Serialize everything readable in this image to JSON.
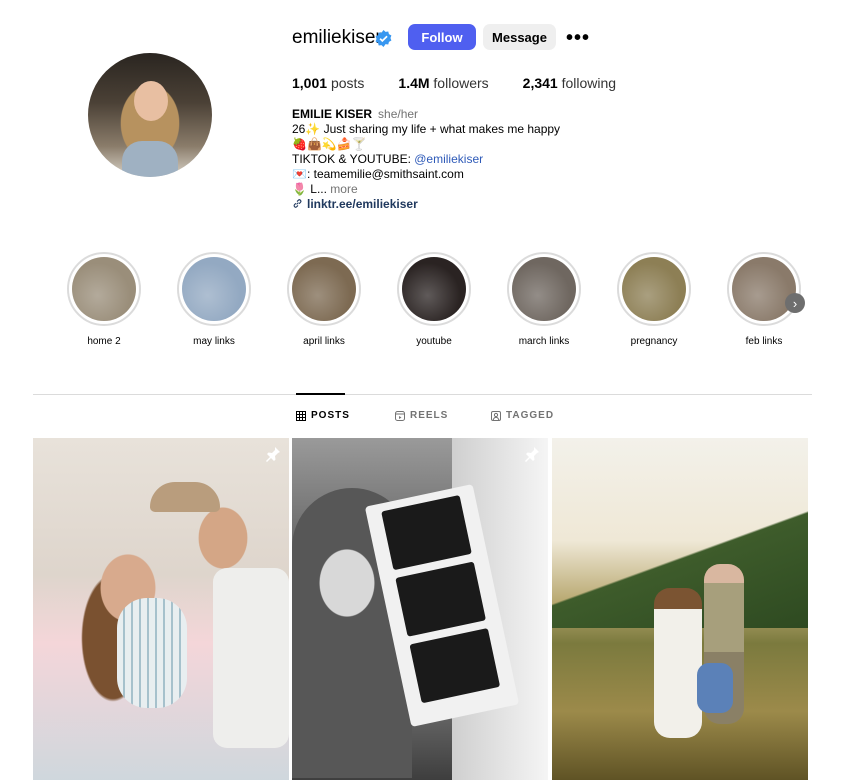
{
  "profile": {
    "username": "emiliekiser",
    "follow_label": "Follow",
    "message_label": "Message",
    "more_label": "•••"
  },
  "stats": {
    "posts_count": "1,001",
    "posts_label": "posts",
    "followers_count": "1.4M",
    "followers_label": "followers",
    "following_count": "2,341",
    "following_label": "following"
  },
  "bio": {
    "name": "EMILIE KISER",
    "pronouns": "she/her",
    "line1": "26✨ Just sharing my life + what makes me happy",
    "line2": "🍓👜💫🍰🍸",
    "line3_prefix": "TIKTOK & YOUTUBE: ",
    "line3_mention": "@emiliekiser",
    "line4": "💌: teamemilie@smithsaint.com",
    "line5_prefix": "🌷 L... ",
    "line5_more": "more",
    "link": "linktr.ee/emiliekiser"
  },
  "highlights": [
    {
      "label": "home 2",
      "color": "#9a8e7a"
    },
    {
      "label": "may links",
      "color": "#93a9c2"
    },
    {
      "label": "april links",
      "color": "#7d6a52"
    },
    {
      "label": "youtube",
      "color": "#2a2322"
    },
    {
      "label": "march links",
      "color": "#6f6760"
    },
    {
      "label": "pregnancy",
      "color": "#8d7f55"
    },
    {
      "label": "feb links",
      "color": "#8a7a6a"
    }
  ],
  "tabs": {
    "posts": "POSTS",
    "reels": "REELS",
    "tagged": "TAGGED"
  },
  "colors": {
    "accent": "#4f5ff0",
    "link": "#2e5ab8"
  }
}
